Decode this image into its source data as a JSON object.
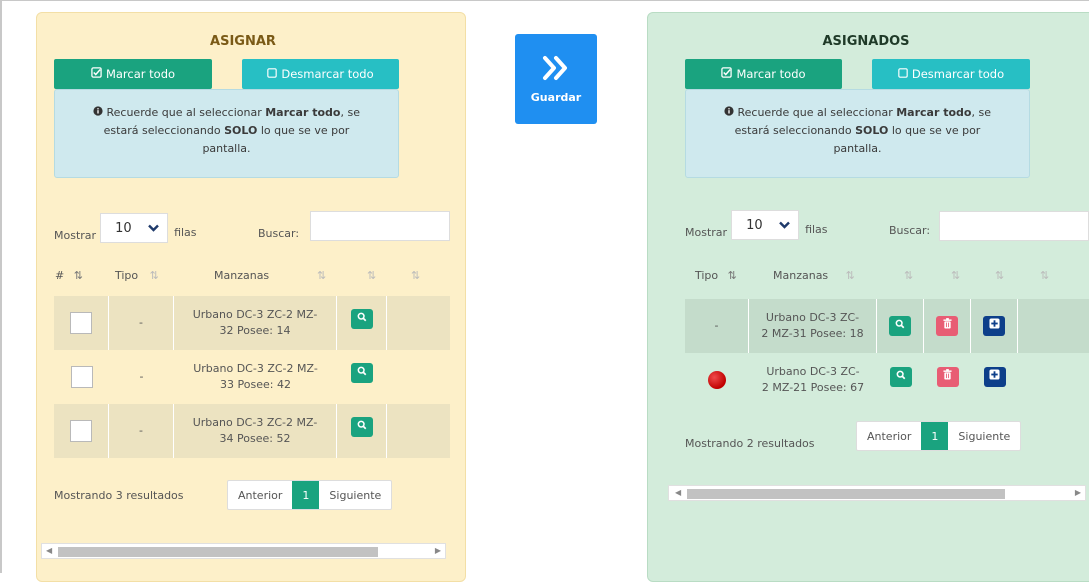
{
  "save_button": {
    "label": "Guardar"
  },
  "left": {
    "title": "ASIGNAR",
    "mark_all": "Marcar todo",
    "unmark_all": "Desmarcar todo",
    "info": {
      "line1_pre": "Recuerde que al seleccionar ",
      "line1_bold": "Marcar todo",
      "line1_post": ", se",
      "line2_pre": "estará seleccionando ",
      "line2_bold": "SOLO",
      "line2_post": " lo que se ve por",
      "line3": "pantalla."
    },
    "show_label": "Mostrar",
    "page_size": "10",
    "rows_label": "filas",
    "search_label": "Buscar:",
    "search_value": "",
    "headers": {
      "hash": "#",
      "tipo": "Tipo",
      "manzanas": "Manzanas"
    },
    "rows": [
      {
        "tipo": "-",
        "manzana_l1": "Urbano DC-3 ZC-2 MZ-",
        "manzana_l2": "32 Posee: 14"
      },
      {
        "tipo": "-",
        "manzana_l1": "Urbano DC-3 ZC-2 MZ-",
        "manzana_l2": "33 Posee: 42"
      },
      {
        "tipo": "-",
        "manzana_l1": "Urbano DC-3 ZC-2 MZ-",
        "manzana_l2": "34 Posee: 52"
      }
    ],
    "result_text": "Mostrando 3 resultados",
    "pager": {
      "prev": "Anterior",
      "current": "1",
      "next": "Siguiente"
    }
  },
  "right": {
    "title": "ASIGNADOS",
    "mark_all": "Marcar todo",
    "unmark_all": "Desmarcar todo",
    "info": {
      "line1_pre": "Recuerde que al seleccionar ",
      "line1_bold": "Marcar todo",
      "line1_post": ", se",
      "line2_pre": "estará seleccionando ",
      "line2_bold": "SOLO",
      "line2_post": " lo que se ve por",
      "line3": "pantalla."
    },
    "show_label": "Mostrar",
    "page_size": "10",
    "rows_label": "filas",
    "search_label": "Buscar:",
    "search_value": "",
    "headers": {
      "tipo": "Tipo",
      "manzanas": "Manzanas"
    },
    "rows": [
      {
        "tipo": "-",
        "manzana_l1": "Urbano DC-3 ZC-",
        "manzana_l2": "2 MZ-31 Posee: 18"
      },
      {
        "tipo": "",
        "manzana_l1": "Urbano DC-3 ZC-",
        "manzana_l2": "2 MZ-21 Posee: 67"
      }
    ],
    "result_text": "Mostrando 2 resultados",
    "pager": {
      "prev": "Anterior",
      "current": "1",
      "next": "Siguiente"
    }
  },
  "icons": {
    "mark": "check-square-icon",
    "unmark": "square-icon",
    "info": "info-circle-icon",
    "save": "double-chevron-right-icon",
    "view": "search-icon",
    "delete": "trash-icon",
    "add": "plus-square-icon",
    "status": "red-dot-icon",
    "sort": "sort-icon"
  },
  "colors": {
    "left_panel_bg": "#fdf0c9",
    "right_panel_bg": "#d3ecdb",
    "mark_button": "#1aa37f",
    "unmark_button": "#27bfc4",
    "save_button": "#1f8ff1",
    "delete_button": "#e85d74",
    "add_button": "#0d3f8a",
    "status_dot": "#d40000"
  }
}
